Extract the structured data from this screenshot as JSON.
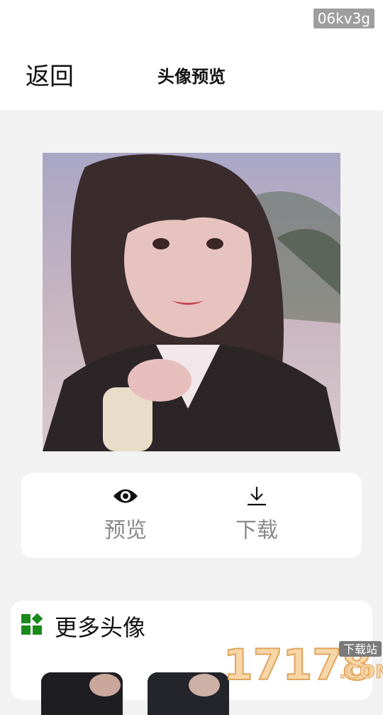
{
  "status": {
    "badge": "06kv3g"
  },
  "header": {
    "back_label": "返回",
    "title": "头像预览"
  },
  "actions": [
    {
      "label": "预览",
      "icon": "eye-icon"
    },
    {
      "label": "下载",
      "icon": "download-icon"
    }
  ],
  "more": {
    "title": "更多头像",
    "icon": "grid-icon",
    "accent": "#1a8a1a"
  },
  "watermark": {
    "number": "17178",
    "tag": "下载站",
    "suffix": ".COM"
  }
}
